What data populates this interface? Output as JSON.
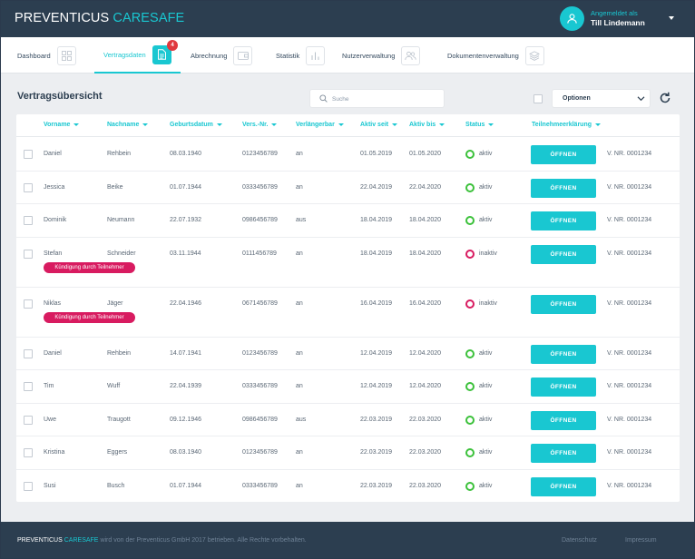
{
  "brand": {
    "part1": "PREVENTICUS",
    "part2": "CARESAFE"
  },
  "user": {
    "caption": "Angemeldet als",
    "name": "Till Lindemann"
  },
  "nav": [
    {
      "label": "Dashboard",
      "icon": "grid-icon"
    },
    {
      "label": "Vertragsdaten",
      "icon": "document-icon",
      "badge": "4",
      "active": true
    },
    {
      "label": "Abrechnung",
      "icon": "wallet-icon"
    },
    {
      "label": "Statistik",
      "icon": "bar-chart-icon"
    },
    {
      "label": "Nutzerverwaltung",
      "icon": "users-icon"
    },
    {
      "label": "Dokumentenverwaltung",
      "icon": "layers-icon"
    }
  ],
  "page_title": "Vertragsübersicht",
  "search": {
    "placeholder": "Suche"
  },
  "options": {
    "label": "Optionen"
  },
  "table": {
    "columns": [
      "Vorname",
      "Nachname",
      "Geburtsdatum",
      "Vers.-Nr.",
      "Verlängerbar",
      "Aktiv seit",
      "Aktiv bis",
      "Status",
      "Teilnehmeerklärung"
    ],
    "button_label": "ÖFFNEN",
    "rows": [
      {
        "first": "Daniel",
        "last": "Rehbein",
        "birth": "08.03.1940",
        "vers": "0123456789",
        "ext": "an",
        "since": "01.05.2019",
        "until": "01.05.2020",
        "status": "aktiv",
        "vnr": "V. NR. 0001234"
      },
      {
        "first": "Jessica",
        "last": "Beike",
        "birth": "01.07.1944",
        "vers": "0333456789",
        "ext": "an",
        "since": "22.04.2019",
        "until": "22.04.2020",
        "status": "aktiv",
        "vnr": "V. NR. 0001234"
      },
      {
        "first": "Dominik",
        "last": "Neumann",
        "birth": "22.07.1932",
        "vers": "0986456789",
        "ext": "aus",
        "since": "18.04.2019",
        "until": "18.04.2020",
        "status": "aktiv",
        "vnr": "V. NR. 0001234"
      },
      {
        "first": "Stefan",
        "last": "Schneider",
        "birth": "03.11.1944",
        "vers": "0111456789",
        "ext": "an",
        "since": "18.04.2019",
        "until": "18.04.2020",
        "status": "inaktiv",
        "vnr": "V. NR. 0001234",
        "tag": "Kündigung durch Teilnehmer"
      },
      {
        "first": "Niklas",
        "last": "Jäger",
        "birth": "22.04.1946",
        "vers": "0671456789",
        "ext": "an",
        "since": "16.04.2019",
        "until": "16.04.2020",
        "status": "inaktiv",
        "vnr": "V. NR. 0001234",
        "tag": "Kündigung durch Teilnehmer"
      },
      {
        "first": "Daniel",
        "last": "Rehbein",
        "birth": "14.07.1941",
        "vers": "0123456789",
        "ext": "an",
        "since": "12.04.2019",
        "until": "12.04.2020",
        "status": "aktiv",
        "vnr": "V. NR. 0001234"
      },
      {
        "first": "Tim",
        "last": "Wuff",
        "birth": "22.04.1939",
        "vers": "0333456789",
        "ext": "an",
        "since": "12.04.2019",
        "until": "12.04.2020",
        "status": "aktiv",
        "vnr": "V. NR. 0001234"
      },
      {
        "first": "Uwe",
        "last": "Traugott",
        "birth": "09.12.1946",
        "vers": "0986456789",
        "ext": "aus",
        "since": "22.03.2019",
        "until": "22.03.2020",
        "status": "aktiv",
        "vnr": "V. NR. 0001234"
      },
      {
        "first": "Kristina",
        "last": "Eggers",
        "birth": "08.03.1940",
        "vers": "0123456789",
        "ext": "an",
        "since": "22.03.2019",
        "until": "22.03.2020",
        "status": "aktiv",
        "vnr": "V. NR. 0001234"
      },
      {
        "first": "Susi",
        "last": "Busch",
        "birth": "01.07.1944",
        "vers": "0333456789",
        "ext": "an",
        "since": "22.03.2019",
        "until": "22.03.2020",
        "status": "aktiv",
        "vnr": "V. NR. 0001234"
      }
    ]
  },
  "footer": {
    "brand1": "PREVENTICUS",
    "brand2": "CARESAFE",
    "text": "wird von der Preventicus GmbH 2017 betrieben. Alle Rechte vorbehalten.",
    "links": [
      "Datenschutz",
      "Impressum"
    ]
  },
  "colors": {
    "accent": "#19c7d1",
    "header": "#2c3e50",
    "active": "#3cc13b",
    "inactive": "#d81b60"
  }
}
